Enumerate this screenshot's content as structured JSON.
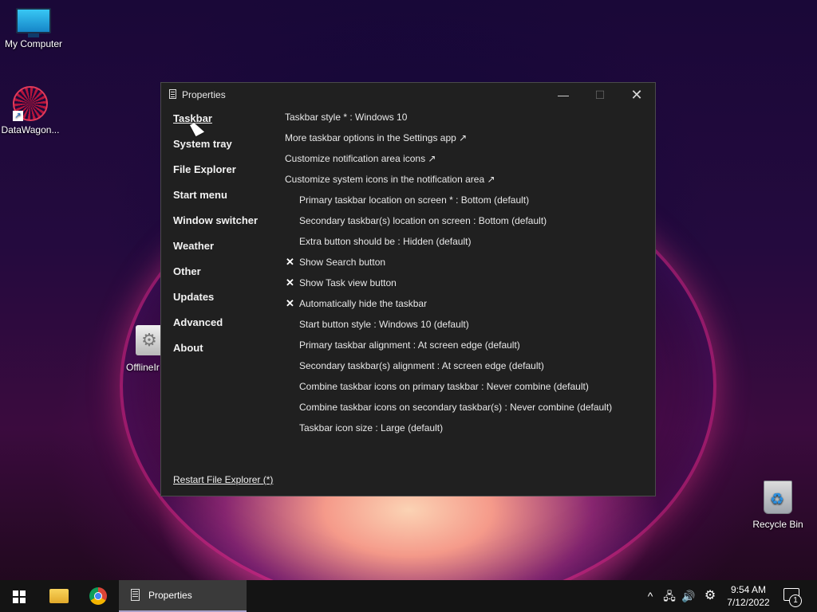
{
  "desktop": {
    "icons": [
      {
        "label": "My Computer"
      },
      {
        "label": "DataWagon..."
      },
      {
        "label": "OfflineIr"
      },
      {
        "label": "Recycle Bin"
      }
    ]
  },
  "window": {
    "title": "Properties",
    "controls": {
      "minimize": "—",
      "maximize": "☐",
      "close": "✕"
    },
    "nav": [
      {
        "label": "Taskbar",
        "active": true
      },
      {
        "label": "System tray"
      },
      {
        "label": "File Explorer"
      },
      {
        "label": "Start menu"
      },
      {
        "label": "Window switcher"
      },
      {
        "label": "Weather"
      },
      {
        "label": "Other"
      },
      {
        "label": "Updates"
      },
      {
        "label": "Advanced"
      },
      {
        "label": "About"
      }
    ],
    "settings": [
      {
        "text": "Taskbar style * : Windows 10"
      },
      {
        "text": "More taskbar options in the Settings app ↗"
      },
      {
        "text": "Customize notification area icons ↗"
      },
      {
        "text": "Customize system icons in the notification area ↗"
      },
      {
        "text": "Primary taskbar location on screen * : Bottom (default)"
      },
      {
        "text": "Secondary taskbar(s) location on screen : Bottom (default)"
      },
      {
        "text": "Extra button should be : Hidden (default)"
      },
      {
        "text": "Show Search button",
        "checked": true
      },
      {
        "text": "Show Task view button",
        "checked": true
      },
      {
        "text": "Automatically hide the taskbar",
        "checked": true
      },
      {
        "text": "Start button style : Windows 10 (default)"
      },
      {
        "text": "Primary taskbar alignment : At screen edge (default)"
      },
      {
        "text": "Secondary taskbar(s) alignment : At screen edge (default)"
      },
      {
        "text": "Combine taskbar icons on primary taskbar : Never combine (default)"
      },
      {
        "text": "Combine taskbar icons on secondary taskbar(s) : Never combine (default)"
      },
      {
        "text": "Taskbar icon size : Large (default)"
      }
    ],
    "check_mark": "✕",
    "restart_link": "Restart File Explorer (*)"
  },
  "taskbar": {
    "apps": [
      {
        "name": "file-explorer-icon"
      },
      {
        "name": "chrome-icon"
      },
      {
        "name": "properties",
        "label": "Properties"
      }
    ],
    "tray": {
      "chevron": "^",
      "network": "🖧",
      "volume": "🔊",
      "settings": "⚙"
    },
    "time": "9:54 AM",
    "date": "7/12/2022",
    "notification_count": "1"
  }
}
